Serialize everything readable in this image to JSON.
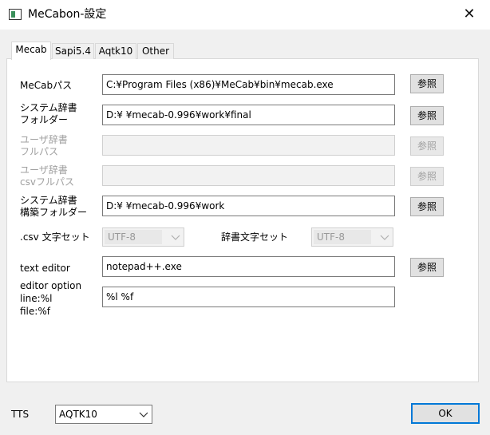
{
  "window": {
    "title": "MeCabon-設定",
    "close": "✕"
  },
  "tabs": [
    "Mecab",
    "Sapi5.4",
    "Aqtk10",
    "Other"
  ],
  "mecab_path": {
    "label": "MeCabパス",
    "value": "C:¥Program Files (x86)¥MeCab¥bin¥mecab.exe",
    "browse": "参照"
  },
  "system_dict": {
    "label1": "システム辞書",
    "label2": "フォルダー",
    "value": "D:¥          ¥mecab-0.996¥work¥final",
    "browse": "参照"
  },
  "user_dict": {
    "label1": "ユーザ辞書",
    "label2": "フルパス",
    "value": "",
    "browse": "参照"
  },
  "user_dict_csv": {
    "label1": "ユーザ辞書",
    "label2": "csvフルパス",
    "value": "",
    "browse": "参照"
  },
  "build_folder": {
    "label1": "システム辞書",
    "label2": "構築フォルダー",
    "value": "D:¥          ¥mecab-0.996¥work",
    "browse": "参照"
  },
  "csv_charset": {
    "label": ".csv 文字セット",
    "value": "UTF-8"
  },
  "dict_charset": {
    "label": "辞書文字セット",
    "value": "UTF-8"
  },
  "text_editor": {
    "label": "text editor",
    "value": "notepad++.exe",
    "browse": "参照"
  },
  "editor_option": {
    "label1": "editor option",
    "label2": "line:%l",
    "label3": "file:%f",
    "value": "%l %f"
  },
  "tts": {
    "label": "TTS",
    "value": "AQTK10"
  },
  "ok": "OK",
  "colors": {
    "accent": "#0078d7",
    "window": "#f0f0f0",
    "panel": "#ffffff"
  }
}
